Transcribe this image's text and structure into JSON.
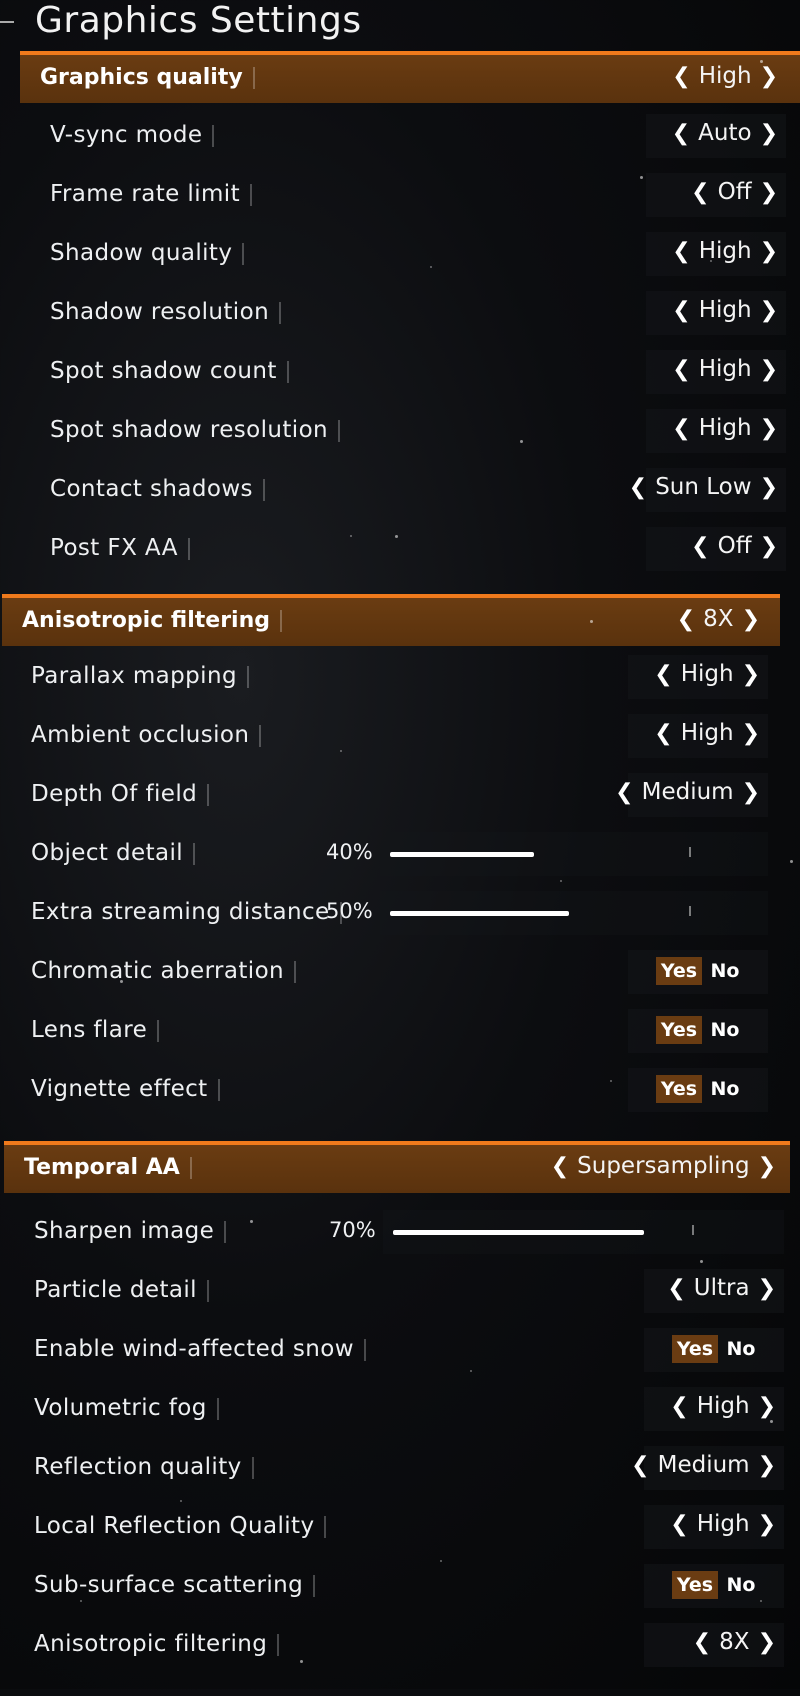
{
  "page": {
    "title": "Graphics Settings"
  },
  "sections": [
    {
      "header": {
        "label": "Graphics quality",
        "value": "High"
      },
      "rows": [
        {
          "label": "V-sync mode",
          "kind": "select",
          "value": "Auto"
        },
        {
          "label": "Frame rate limit",
          "kind": "select",
          "value": "Off"
        },
        {
          "label": "Shadow quality",
          "kind": "select",
          "value": "High"
        },
        {
          "label": "Shadow resolution",
          "kind": "select",
          "value": "High"
        },
        {
          "label": "Spot shadow count",
          "kind": "select",
          "value": "High"
        },
        {
          "label": "Spot shadow resolution",
          "kind": "select",
          "value": "High"
        },
        {
          "label": "Contact shadows",
          "kind": "select",
          "value": "Sun Low"
        },
        {
          "label": "Post FX AA",
          "kind": "select",
          "value": "Off"
        }
      ]
    },
    {
      "header": {
        "label": "Anisotropic filtering",
        "value": "8X"
      },
      "rows": [
        {
          "label": "Parallax mapping",
          "kind": "select",
          "value": "High"
        },
        {
          "label": "Ambient occlusion",
          "kind": "select",
          "value": "High"
        },
        {
          "label": "Depth Of field",
          "kind": "select",
          "value": "Medium"
        },
        {
          "label": "Object detail",
          "kind": "slider",
          "value": "40%",
          "level": 0.4
        },
        {
          "label": "Extra streaming distance",
          "kind": "slider",
          "value": "50%",
          "level": 0.5
        },
        {
          "label": "Chromatic aberration",
          "kind": "toggle",
          "yes": "Yes",
          "no": "No",
          "selected": "yes"
        },
        {
          "label": "Lens flare",
          "kind": "toggle",
          "yes": "Yes",
          "no": "No",
          "selected": "yes"
        },
        {
          "label": "Vignette effect",
          "kind": "toggle",
          "yes": "Yes",
          "no": "No",
          "selected": "yes"
        }
      ]
    },
    {
      "header": {
        "label": "Temporal AA",
        "value": "Supersampling"
      },
      "rows": [
        {
          "label": "Sharpen image",
          "kind": "slider",
          "value": "70%",
          "level": 0.7
        },
        {
          "label": "Particle detail",
          "kind": "select",
          "value": "Ultra"
        },
        {
          "label": "Enable wind-affected snow",
          "kind": "toggle",
          "yes": "Yes",
          "no": "No",
          "selected": "yes"
        },
        {
          "label": "Volumetric fog",
          "kind": "select",
          "value": "High"
        },
        {
          "label": "Reflection quality",
          "kind": "select",
          "value": "Medium"
        },
        {
          "label": "Local Reflection Quality",
          "kind": "select",
          "value": "High"
        },
        {
          "label": "Sub-surface scattering",
          "kind": "toggle",
          "yes": "Yes",
          "no": "No",
          "selected": "yes"
        },
        {
          "label": "Anisotropic filtering",
          "kind": "select",
          "value": "8X"
        }
      ]
    }
  ],
  "icons": {
    "prev": "chevron-left-icon",
    "next": "chevron-right-icon"
  },
  "colors": {
    "accent": "#f07a1c",
    "header_bg": "#6a3c12",
    "toggle_on": "#6a3c12"
  }
}
